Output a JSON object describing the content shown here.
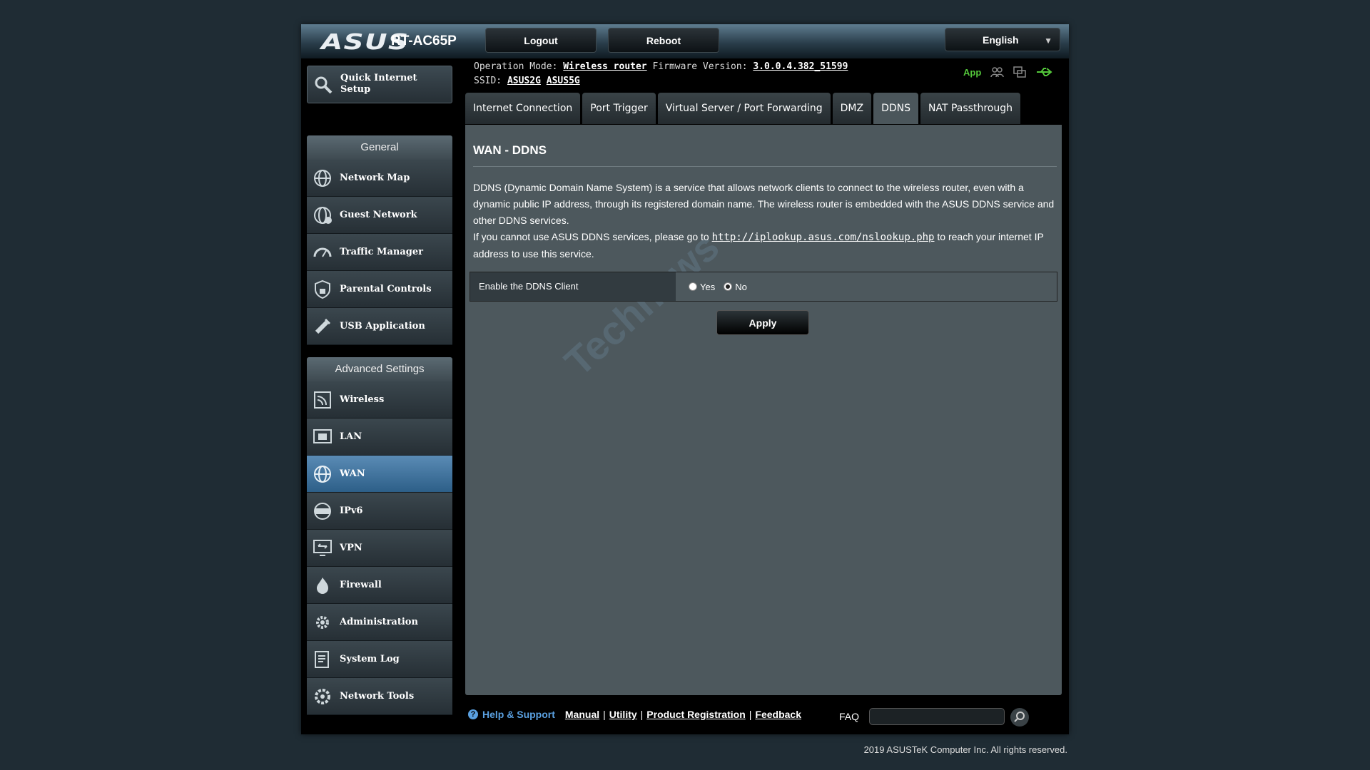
{
  "header": {
    "brand": "ASUS",
    "model": "RT-AC65P",
    "logout_label": "Logout",
    "reboot_label": "Reboot",
    "language": "English"
  },
  "info": {
    "operation_mode_label": "Operation Mode:",
    "operation_mode_value": "Wireless router",
    "firmware_label": "Firmware Version:",
    "firmware_value": "3.0.0.4.382_51599",
    "ssid_label": "SSID:",
    "ssid_1": "ASUS2G",
    "ssid_2": "ASUS5G",
    "app_label": "App"
  },
  "sidebar": {
    "quick_setup_label": "Quick Internet Setup",
    "general_title": "General",
    "general_items": [
      {
        "label": "Network Map"
      },
      {
        "label": "Guest Network"
      },
      {
        "label": "Traffic Manager"
      },
      {
        "label": "Parental Controls"
      },
      {
        "label": "USB Application"
      }
    ],
    "advanced_title": "Advanced Settings",
    "advanced_items": [
      {
        "label": "Wireless"
      },
      {
        "label": "LAN"
      },
      {
        "label": "WAN"
      },
      {
        "label": "IPv6"
      },
      {
        "label": "VPN"
      },
      {
        "label": "Firewall"
      },
      {
        "label": "Administration"
      },
      {
        "label": "System Log"
      },
      {
        "label": "Network Tools"
      }
    ]
  },
  "tabs": [
    {
      "label": "Internet Connection"
    },
    {
      "label": "Port Trigger"
    },
    {
      "label": "Virtual Server / Port Forwarding"
    },
    {
      "label": "DMZ"
    },
    {
      "label": "DDNS"
    },
    {
      "label": "NAT Passthrough"
    }
  ],
  "page": {
    "title": "WAN - DDNS",
    "desc_1": "DDNS (Dynamic Domain Name System) is a service that allows network clients to connect to the wireless router, even with a dynamic public IP address, through its registered domain name. The wireless router is embedded with the ASUS DDNS service and other DDNS services.",
    "desc_2_pre": "If you cannot use ASUS DDNS services, please go to ",
    "desc_2_link": "http://iplookup.asus.com/nslookup.php",
    "desc_2_post": " to reach your internet IP address to use this service.",
    "enable_label": "Enable the DDNS Client",
    "yes_label": "Yes",
    "no_label": "No",
    "selected": "No",
    "apply_label": "Apply",
    "watermark": "Technews"
  },
  "footer": {
    "help_label": "Help & Support",
    "manual": "Manual",
    "utility": "Utility",
    "product_registration": "Product Registration",
    "feedback": "Feedback",
    "faq_label": "FAQ",
    "copyright": "2019 ASUSTeK Computer Inc. All rights reserved."
  }
}
